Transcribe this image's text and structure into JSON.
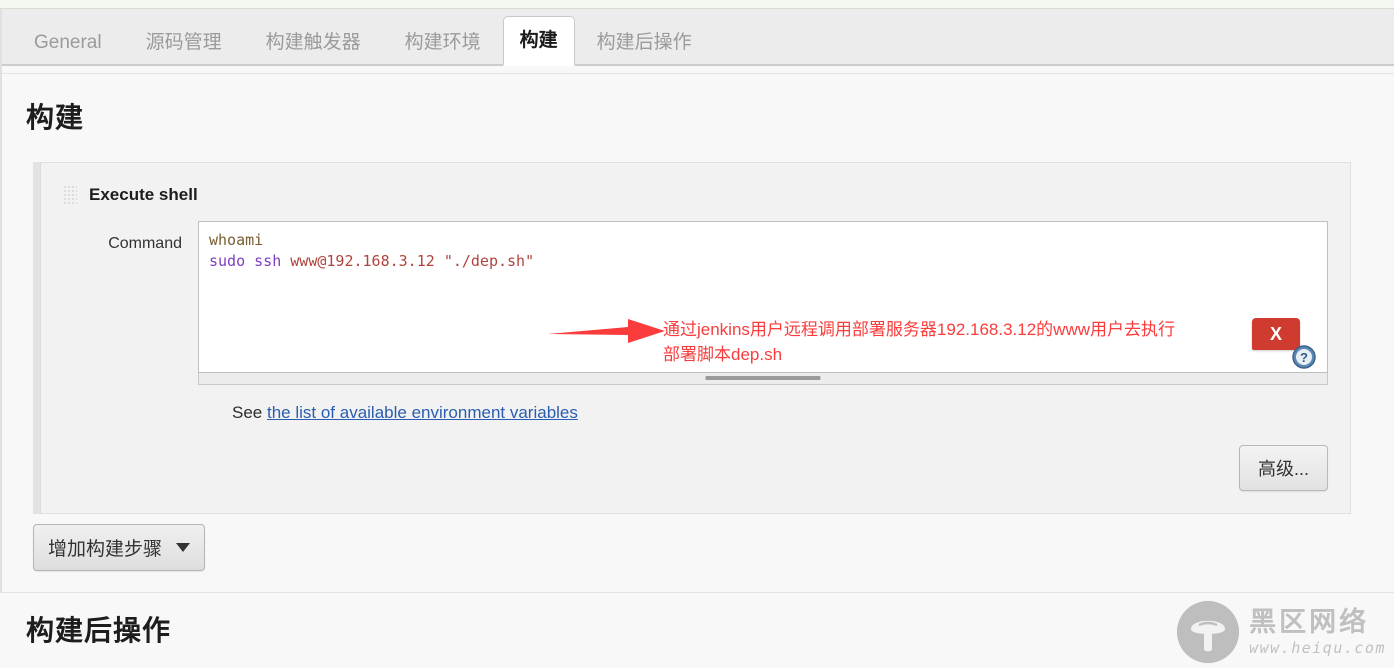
{
  "tabs": [
    {
      "label": "General",
      "active": false
    },
    {
      "label": "源码管理",
      "active": false
    },
    {
      "label": "构建触发器",
      "active": false
    },
    {
      "label": "构建环境",
      "active": false
    },
    {
      "label": "构建",
      "active": true
    },
    {
      "label": "构建后操作",
      "active": false
    }
  ],
  "build_section": {
    "title": "构建",
    "step": {
      "name": "Execute shell",
      "close_label": "X",
      "help_icon": "help-circle-icon",
      "drag_icon": "drag-grip-icon",
      "command": {
        "label": "Command",
        "line1": "whoami",
        "line2_kw": "sudo ssh",
        "line2_arg": " www@192.168.3.12 ",
        "line2_str": "\"./dep.sh\"",
        "full_value": "whoami\nsudo ssh www@192.168.3.12 \"./dep.sh\"",
        "placeholder": ""
      },
      "see_text": "See",
      "see_link": "the list of available environment variables",
      "advanced_button": "高级..."
    },
    "add_step_button": "增加构建步骤",
    "caret_icon": "chevron-down-icon"
  },
  "annotation": {
    "line1": "通过jenkins用户远程调用部署服务器192.168.3.12的www用户去执行",
    "line2": "部署脚本dep.sh",
    "arrow_icon": "right-arrow-icon",
    "color": "#fa3c3c"
  },
  "post_build_section": {
    "title": "构建后操作"
  },
  "watermark": {
    "logo_icon": "mushroom-logo-icon",
    "name": "黑区网络",
    "url": "www.heiqu.com"
  },
  "colors": {
    "accent_red": "#d03b2f",
    "link_blue": "#2a5db0",
    "annotation_red": "#fa3c3c",
    "panel_bg": "#f2f2f2",
    "page_bg": "#f7f8f7"
  }
}
